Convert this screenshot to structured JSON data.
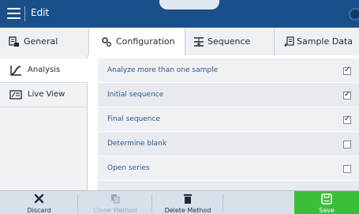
{
  "titlebar": {
    "title": "Edit"
  },
  "tabs": [
    {
      "label": "General",
      "icon": "general-icon",
      "active": false
    },
    {
      "label": "Configuration",
      "icon": "gears-icon",
      "active": true
    },
    {
      "label": "Sequence",
      "icon": "sequence-icon",
      "active": false
    },
    {
      "label": "Sample Data",
      "icon": "sample-data-icon",
      "active": false
    }
  ],
  "nav": [
    {
      "label": "Analysis",
      "icon": "analysis-curve-icon",
      "active": true
    },
    {
      "label": "Live View",
      "icon": "live-view-icon",
      "active": false
    }
  ],
  "rows": [
    {
      "label": "Analyze more than one sample",
      "checked": true
    },
    {
      "label": "Initial sequence",
      "checked": true
    },
    {
      "label": "Final sequence",
      "checked": true
    },
    {
      "label": "Determine blank",
      "checked": false
    },
    {
      "label": "Open series",
      "checked": false
    }
  ],
  "check_glyph": "✓",
  "toolbar": {
    "discard": "Discard",
    "clone": "Clone Method",
    "delete": "Delete Method",
    "save": "Save"
  },
  "colors": {
    "titlebar": "#1a4f8a",
    "save": "#3bbf3b",
    "row_text": "#2a5b8c"
  }
}
